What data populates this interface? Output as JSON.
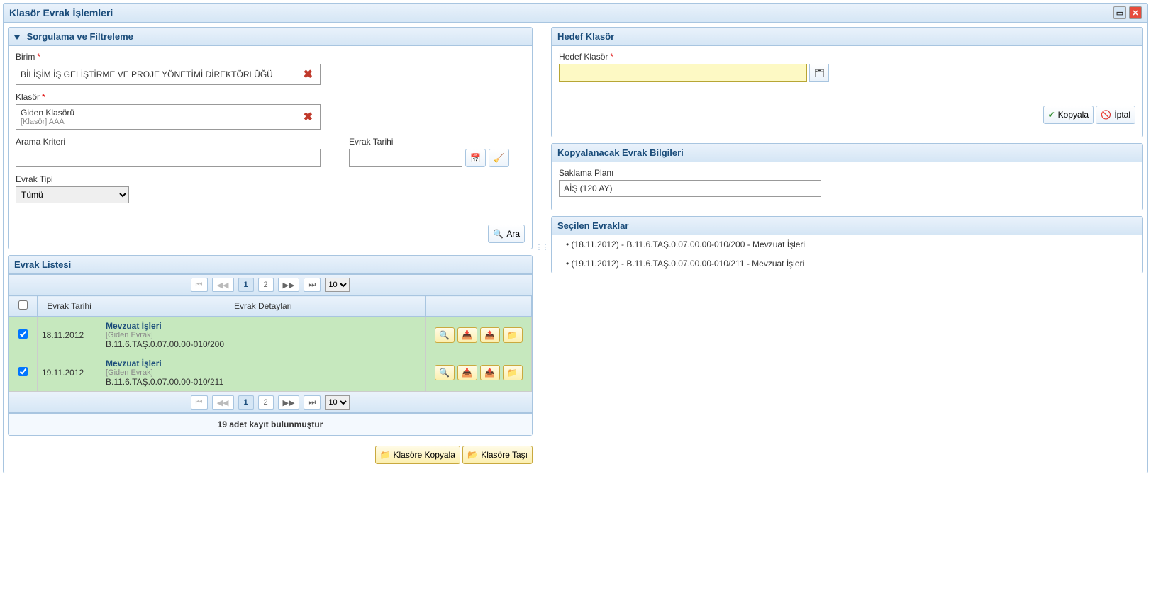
{
  "window": {
    "title": "Klasör Evrak İşlemleri"
  },
  "filter": {
    "header": "Sorgulama ve Filtreleme",
    "birim_label": "Birim",
    "birim_value": "BİLİŞİM İŞ GELİŞTİRME VE PROJE YÖNETİMİ DİREKTÖRLÜĞÜ",
    "klasor_label": "Klasör",
    "klasor_value": "Giden Klasörü",
    "klasor_sub": "[Klasör] AAA",
    "arama_label": "Arama Kriteri",
    "tarih_label": "Evrak Tarihi",
    "tip_label": "Evrak Tipi",
    "tip_value": "Tümü",
    "search_btn": "Ara"
  },
  "list": {
    "header": "Evrak Listesi",
    "col_checkbox": "",
    "col_date": "Evrak Tarihi",
    "col_details": "Evrak Detayları",
    "pages": [
      "1",
      "2"
    ],
    "page_size": "10",
    "status": "19 adet kayıt bulunmuştur",
    "rows": [
      {
        "checked": true,
        "date": "18.11.2012",
        "title": "Mevzuat İşleri",
        "sub": "[Giden Evrak]",
        "code": "B.11.6.TAŞ.0.07.00.00-010/200"
      },
      {
        "checked": true,
        "date": "19.11.2012",
        "title": "Mevzuat İşleri",
        "sub": "[Giden Evrak]",
        "code": "B.11.6.TAŞ.0.07.00.00-010/211"
      }
    ]
  },
  "bottom": {
    "copy_btn": "Klasöre Kopyala",
    "move_btn": "Klasöre Taşı"
  },
  "target": {
    "header": "Hedef Klasör",
    "label": "Hedef Klasör",
    "copy_btn": "Kopyala",
    "cancel_btn": "İptal"
  },
  "copy_info": {
    "header": "Kopyalanacak Evrak Bilgileri",
    "plan_label": "Saklama Planı",
    "plan_value": "AİŞ (120 AY)"
  },
  "selected": {
    "header": "Seçilen Evraklar",
    "items": [
      "(18.11.2012) - B.11.6.TAŞ.0.07.00.00-010/200 - Mevzuat İşleri",
      "(19.11.2012) - B.11.6.TAŞ.0.07.00.00-010/211 - Mevzuat İşleri"
    ]
  }
}
